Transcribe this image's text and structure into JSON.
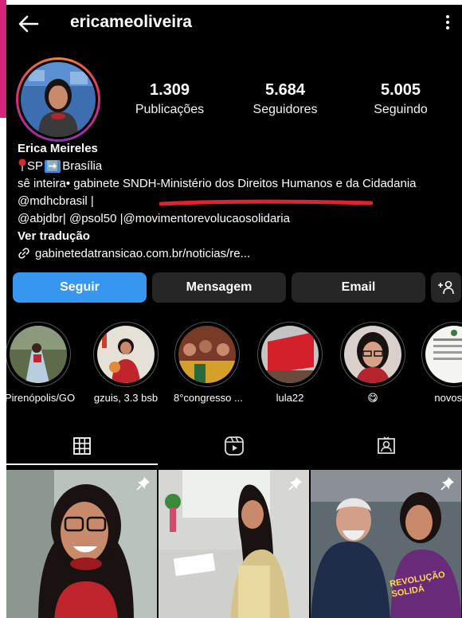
{
  "header": {
    "username": "ericameoliveira"
  },
  "stats": [
    {
      "value": "1.309",
      "label": "Publicações"
    },
    {
      "value": "5.684",
      "label": "Seguidores"
    },
    {
      "value": "5.005",
      "label": "Seguindo"
    }
  ],
  "bio": {
    "name": "Erica Meireles",
    "location_from": "SP",
    "location_arrow": "➡️",
    "location_to": "Brasília",
    "line1": "sê inteira• gabinete SNDH-Ministério dos Direitos Humanos e da Cidadania",
    "line2": "@mdhcbrasil |",
    "line3": "@abjdbr| @psol50 |@movimentorevolucaosolidaria",
    "translate": "Ver tradução",
    "link": "gabinetedatransicao.com.br/noticias/re..."
  },
  "buttons": {
    "follow": "Seguir",
    "message": "Mensagem",
    "email": "Email"
  },
  "highlights": [
    {
      "label": "Pirenópolis/GO"
    },
    {
      "label": "gzuis, 3.3 bsb"
    },
    {
      "label": "8°congresso ..."
    },
    {
      "label": "lula22"
    },
    {
      "label": "😋"
    },
    {
      "label": "novos te"
    }
  ],
  "grid_posts": [
    {
      "pinned": true,
      "image_text": ""
    },
    {
      "pinned": true,
      "image_text": ""
    },
    {
      "pinned": true,
      "image_text": "REVOLUÇÃO SOLIDÁ"
    }
  ],
  "colors": {
    "accent": "#3797f0",
    "button_dark": "#262626",
    "underline": "#e0242e"
  }
}
